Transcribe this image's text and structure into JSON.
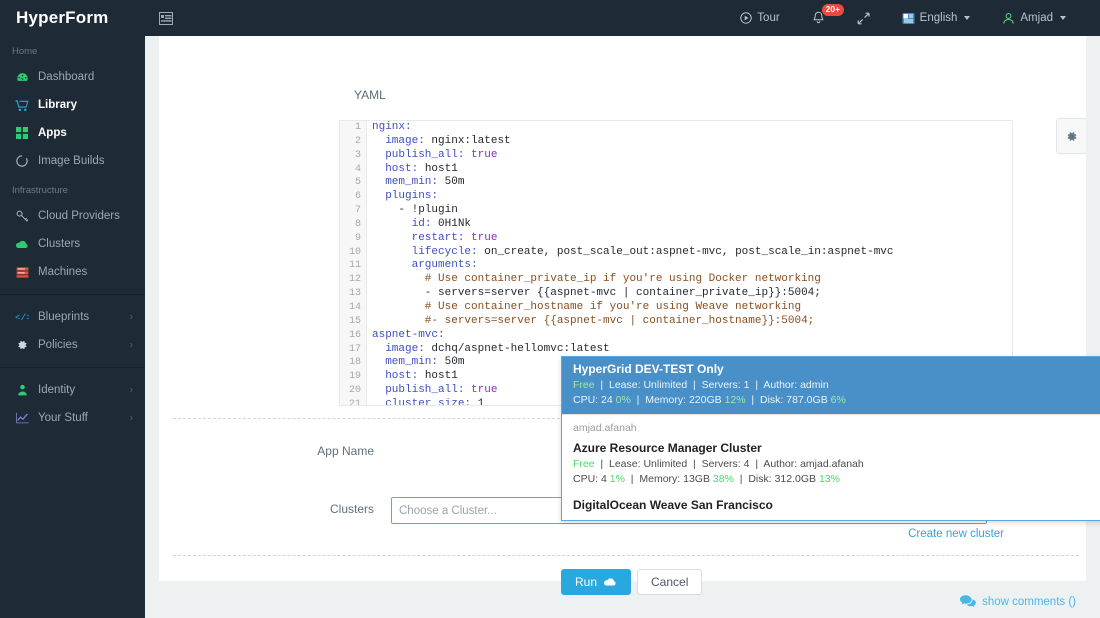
{
  "brand": {
    "name": "HyperForm"
  },
  "topbar": {
    "menu_icon": "sidebar-collapse-icon",
    "tour_label": "Tour",
    "notifications_badge": "20+",
    "expand_icon": "expand-arrows-icon",
    "language_label": "English",
    "user_label": "Amjad"
  },
  "sidebar": {
    "groups": [
      {
        "title": "Home",
        "items": [
          {
            "label": "Dashboard",
            "icon": "dashboard-icon",
            "active": false,
            "chevron": false
          },
          {
            "label": "Library",
            "icon": "cart-icon",
            "active": true,
            "chevron": false
          },
          {
            "label": "Apps",
            "icon": "grid-icon",
            "active": true,
            "chevron": false
          },
          {
            "label": "Image Builds",
            "icon": "spinner-icon",
            "active": false,
            "chevron": false
          }
        ]
      },
      {
        "title": "Infrastructure",
        "items": [
          {
            "label": "Cloud Providers",
            "icon": "key-icon",
            "active": false,
            "chevron": false
          },
          {
            "label": "Clusters",
            "icon": "cloud-icon",
            "active": false,
            "chevron": false
          },
          {
            "label": "Machines",
            "icon": "server-icon",
            "active": false,
            "chevron": false
          }
        ]
      },
      {
        "title": "",
        "items": [
          {
            "label": "Blueprints",
            "icon": "code-icon",
            "active": false,
            "chevron": true
          },
          {
            "label": "Policies",
            "icon": "gear-icon",
            "active": false,
            "chevron": true
          }
        ]
      },
      {
        "title": "",
        "items": [
          {
            "label": "Identity",
            "icon": "user-icon",
            "active": false,
            "chevron": true
          },
          {
            "label": "Your Stuff",
            "icon": "chart-icon",
            "active": false,
            "chevron": true
          }
        ]
      }
    ]
  },
  "editor": {
    "format_label": "YAML",
    "line_numbers": [
      "1",
      "2",
      "3",
      "4",
      "5",
      "6",
      "7",
      "8",
      "9",
      "10",
      "11",
      "12",
      "13",
      "14",
      "15",
      "16",
      "17",
      "18",
      "19",
      "20",
      "21"
    ],
    "lines": [
      "nginx:",
      "  image: nginx:latest",
      "  publish_all: true",
      "  host: host1",
      "  mem_min: 50m",
      "  plugins:",
      "    - !plugin",
      "      id: 0H1Nk",
      "      restart: true",
      "      lifecycle: on_create, post_scale_out:aspnet-mvc, post_scale_in:aspnet-mvc",
      "      arguments:",
      "        # Use container_private_ip if you're using Docker networking",
      "        - servers=server {{aspnet-mvc | container_private_ip}}:5004;",
      "        # Use container_hostname if you're using Weave networking",
      "        #- servers=server {{aspnet-mvc | container_hostname}}:5004;",
      "aspnet-mvc:",
      "  image: dchq/aspnet-hellomvc:latest",
      "  mem_min: 50m",
      "  host: host1",
      "  publish_all: true",
      "  cluster_size: 1"
    ]
  },
  "dropdown": {
    "selected": {
      "title": "HyperGrid DEV-TEST Only",
      "price": "Free",
      "lease": "Lease: Unlimited",
      "servers": "Servers: 1",
      "author": "Author: admin",
      "cpu": "CPU: 24",
      "cpu_pct": "0%",
      "memory": "Memory: 220GB",
      "memory_pct": "12%",
      "disk": "Disk: 787.0GB",
      "disk_pct": "6%"
    },
    "group_label": "amjad.afanah",
    "items": [
      {
        "title": "Azure Resource Manager Cluster",
        "price": "Free",
        "lease": "Lease: Unlimited",
        "servers": "Servers: 4",
        "author": "Author: amjad.afanah",
        "cpu": "CPU: 4",
        "cpu_pct": "1%",
        "memory": "Memory: 13GB",
        "memory_pct": "38%",
        "disk": "Disk: 312.0GB",
        "disk_pct": "13%"
      }
    ],
    "partial_item_title": "DigitalOcean Weave San Francisco"
  },
  "form": {
    "app_name_label": "App Name",
    "clusters_label": "Clusters",
    "clusters_placeholder": "Choose a Cluster...",
    "clusters_value": "",
    "create_cluster_link": "Create new cluster",
    "run_label": "Run",
    "run_icon": "cloud-icon",
    "cancel_label": "Cancel"
  },
  "footer": {
    "comments_icon": "comment-bubble-icon",
    "comments_label": "show comments ()"
  },
  "settings_tab": {
    "icon": "gear-icon"
  },
  "colors": {
    "sidebar": "#1e2b36",
    "accent": "#29a8e0",
    "select_blue": "#4a90c8",
    "badge_red": "#e74c3c",
    "green": "#4cd964"
  }
}
